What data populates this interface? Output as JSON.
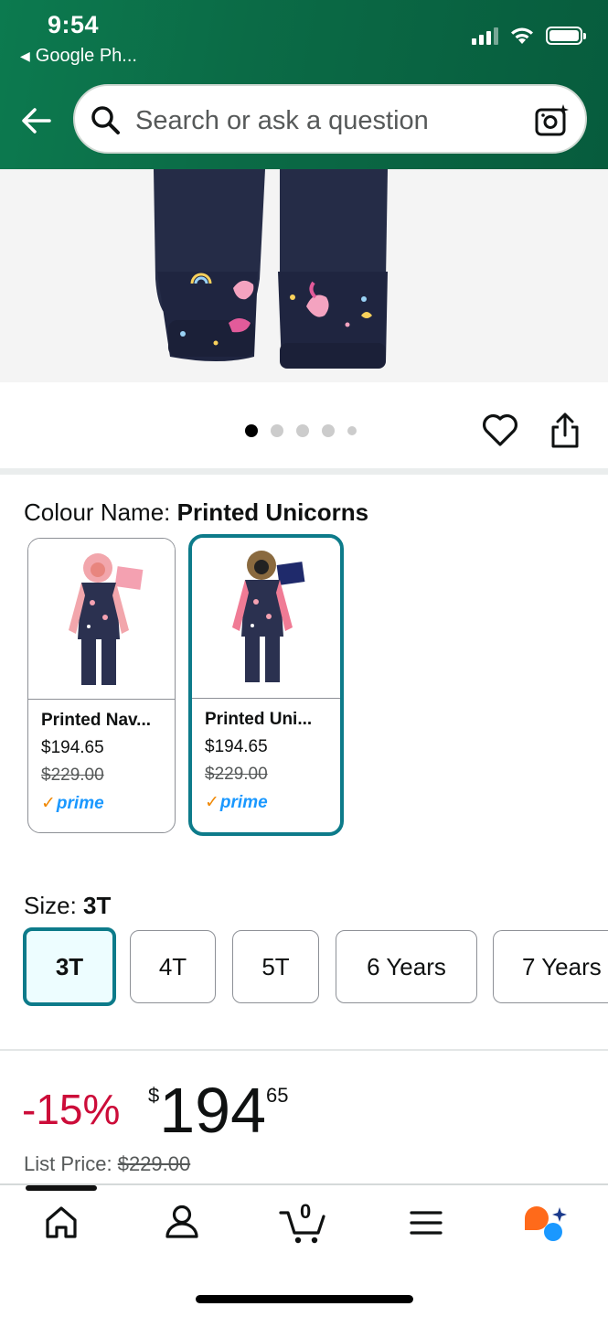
{
  "status_bar": {
    "time": "9:54",
    "back_app": "Google Ph..."
  },
  "header": {
    "search_placeholder": "Search or ask a question"
  },
  "carousel": {
    "dot_count": 5,
    "active_index": 0
  },
  "colour": {
    "label": "Colour Name: ",
    "selected_value": "Printed Unicorns",
    "options": [
      {
        "name": "Printed Nav...",
        "price": "$194.65",
        "list_price": "$229.00",
        "prime": "prime",
        "selected": false
      },
      {
        "name": "Printed Uni...",
        "price": "$194.65",
        "list_price": "$229.00",
        "prime": "prime",
        "selected": true
      }
    ]
  },
  "size": {
    "label": "Size: ",
    "selected_value": "3T",
    "options": [
      "3T",
      "4T",
      "5T",
      "6 Years",
      "7 Years"
    ]
  },
  "price": {
    "discount": "-15%",
    "currency": "$",
    "whole": "194",
    "fraction": "65",
    "list_label": "List Price: ",
    "list_value": "$229.00"
  },
  "bottom_nav": {
    "cart_count": "0",
    "items": [
      "home-icon",
      "account-icon",
      "cart-icon",
      "menu-icon",
      "rufus-assistant-icon"
    ]
  },
  "colors": {
    "header_green": "#0b6b46",
    "selected_border": "#0d7b8a",
    "discount_red": "#cc0c39",
    "prime_blue": "#1a98ff"
  }
}
